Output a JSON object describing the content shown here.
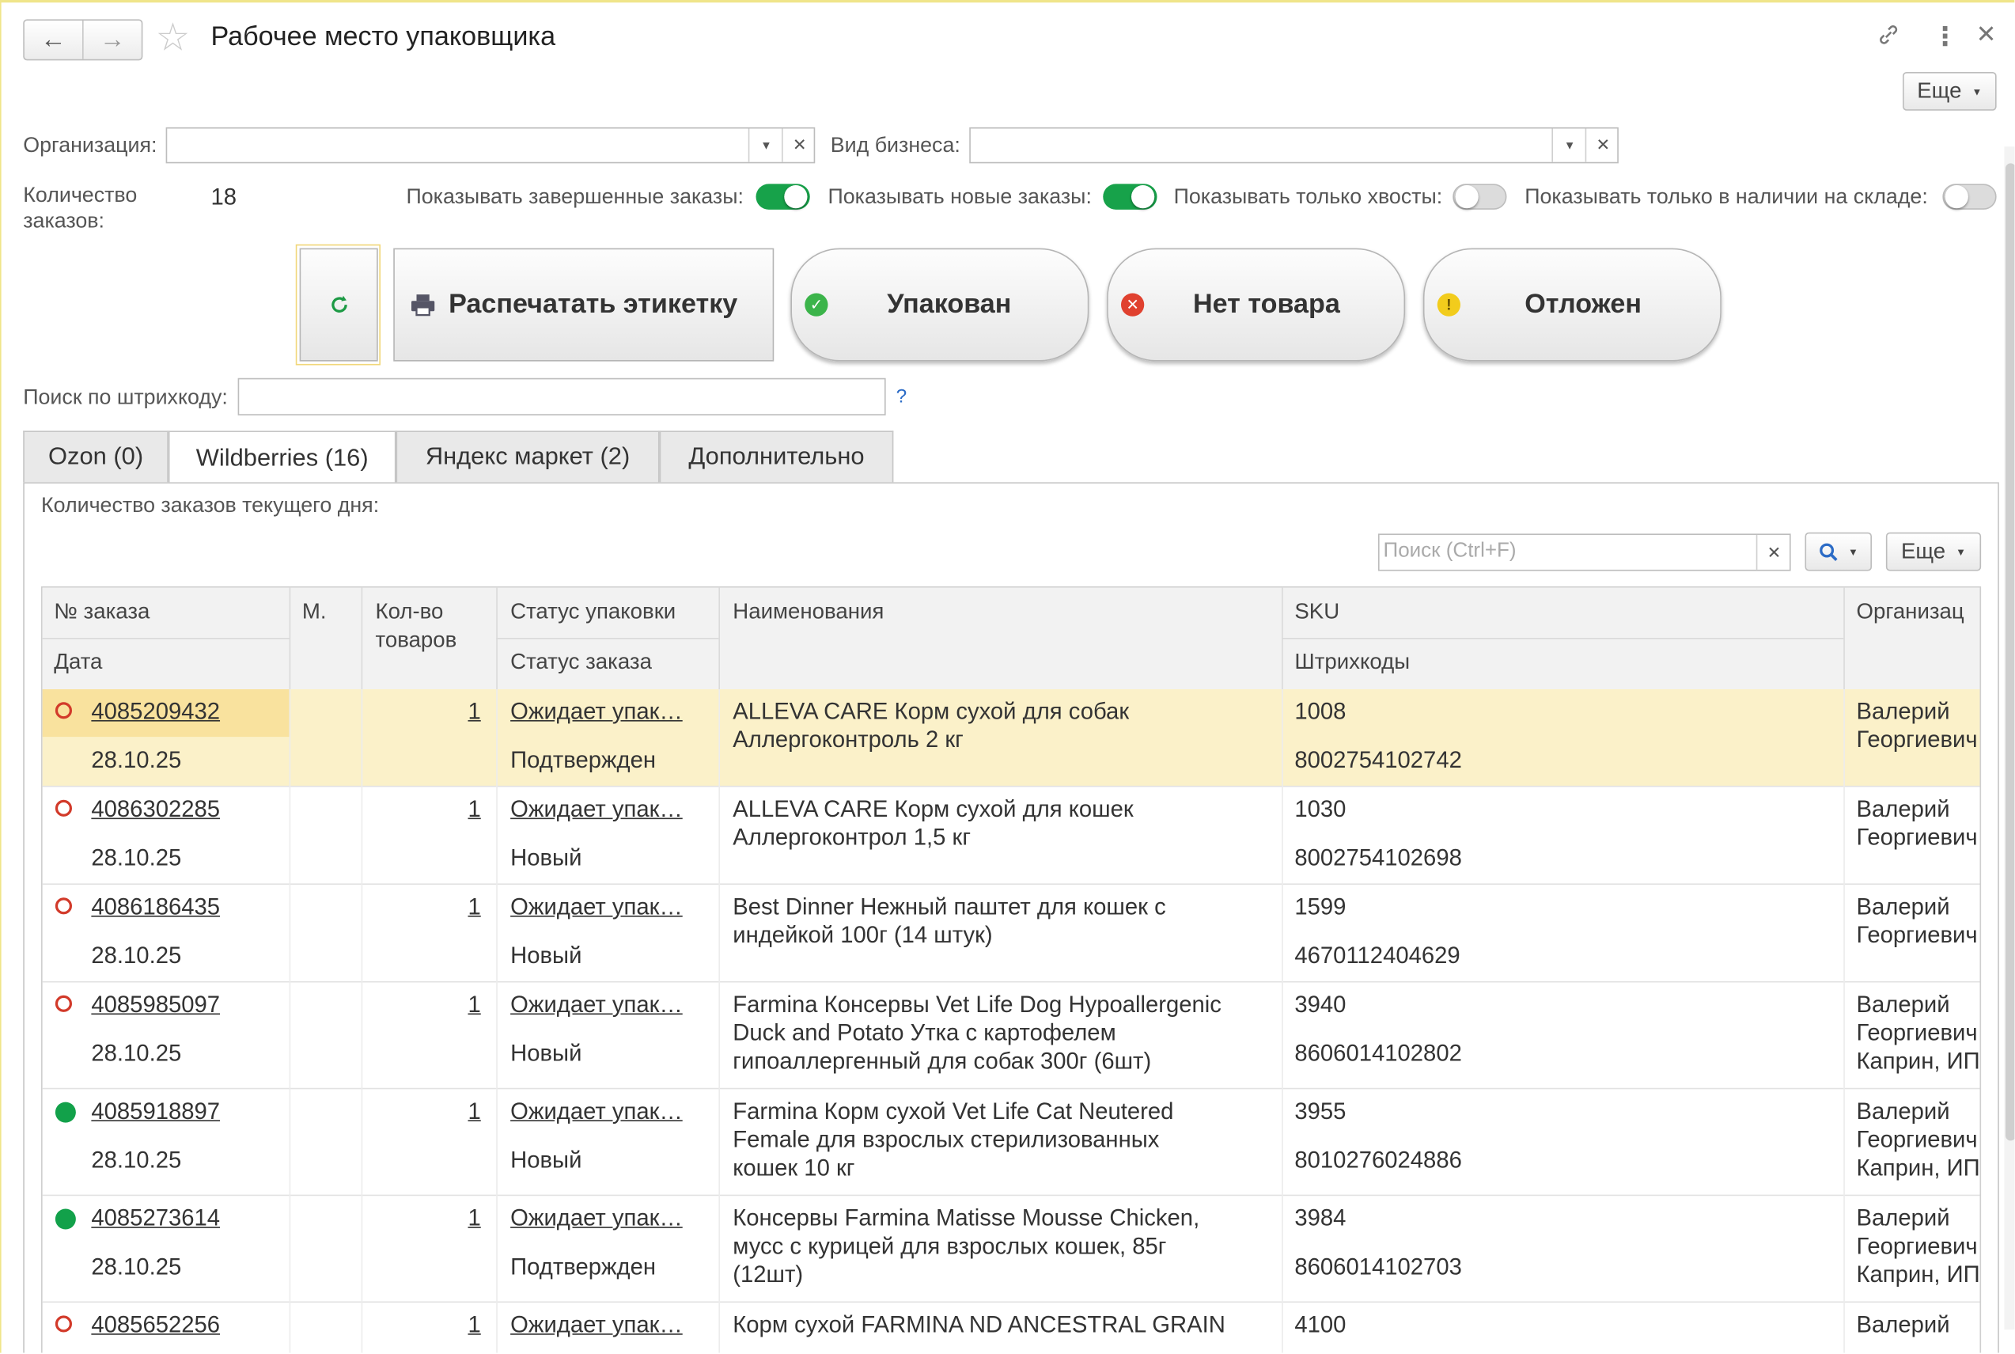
{
  "window": {
    "title": "Рабочее место упаковщика",
    "back_icon": "←",
    "forward_icon": "→",
    "more_label": "Еще"
  },
  "filters": {
    "organization_label": "Организация:",
    "business_label": "Вид бизнеса:",
    "orders_count_label_1": "Количество",
    "orders_count_label_2": "заказов:",
    "orders_count_value": "18",
    "show_completed_label": "Показывать завершенные заказы:",
    "show_new_label": "Показывать новые заказы:",
    "show_tails_label": "Показывать только хвосты:",
    "show_in_stock_label": "Показывать только в наличии на складе:",
    "show_completed": true,
    "show_new": true,
    "show_tails": false,
    "show_in_stock": false
  },
  "actions": {
    "print_label": "Распечатать этикетку",
    "packed_label": "Упакован",
    "no_item_label": "Нет товара",
    "postponed_label": "Отложен"
  },
  "barcode_search": {
    "label": "Поиск по штрихкоду:",
    "help": "?"
  },
  "tabs": [
    {
      "label": "Ozon (0)"
    },
    {
      "label": "Wildberries (16)"
    },
    {
      "label": "Яндекс маркет (2)"
    },
    {
      "label": "Дополнительно"
    }
  ],
  "panel": {
    "today_orders_label": "Количество заказов текущего дня:",
    "search_placeholder": "Поиск (Ctrl+F)",
    "more_label": "Еще"
  },
  "table": {
    "headers": {
      "order_no": "№ заказа",
      "date": "Дата",
      "m": "М.",
      "qty_1": "Кол-во",
      "qty_2": "товаров",
      "pack_status": "Статус упаковки",
      "order_status": "Статус заказа",
      "names": "Наименования",
      "sku": "SKU",
      "barcodes": "Штрихкоды",
      "org": "Организац"
    },
    "rows": [
      {
        "marker": "ring",
        "order": "4085209432",
        "date": "28.10.25",
        "qty": "1",
        "pack_status": "Ожидает упак…",
        "order_status": "Подтвержден",
        "name": [
          "ALLEVA CARE Корм сухой для собак",
          "Аллергоконтроль 2 кг"
        ],
        "sku": "1008",
        "barcode": "8002754102742",
        "org": [
          "Валерий",
          "Георгиевич"
        ]
      },
      {
        "marker": "ring",
        "order": "4086302285",
        "date": "28.10.25",
        "qty": "1",
        "pack_status": "Ожидает упак…",
        "order_status": "Новый",
        "name": [
          "ALLEVA CARE Корм сухой для кошек",
          "Аллергоконтрол 1,5 кг"
        ],
        "sku": "1030",
        "barcode": "8002754102698",
        "org": [
          "Валерий",
          "Георгиевич"
        ]
      },
      {
        "marker": "ring",
        "order": "4086186435",
        "date": "28.10.25",
        "qty": "1",
        "pack_status": "Ожидает упак…",
        "order_status": "Новый",
        "name": [
          "Best Dinner Нежный паштет для кошек с",
          "индейкой 100г (14 штук)"
        ],
        "sku": "1599",
        "barcode": "4670112404629",
        "org": [
          "Валерий",
          "Георгиевич"
        ]
      },
      {
        "marker": "ring",
        "order": "4085985097",
        "date": "28.10.25",
        "qty": "1",
        "pack_status": "Ожидает упак…",
        "order_status": "Новый",
        "name": [
          "Farmina Консервы Vet Life Dog Hypoallergenic",
          "Duck and Potato Утка с картофелем",
          "гипоаллергенный для собак 300г (6шт)"
        ],
        "sku": "3940",
        "barcode": "8606014102802",
        "org": [
          "Валерий",
          "Георгиевич",
          "Каприн, ИП"
        ]
      },
      {
        "marker": "dot",
        "order": "4085918897",
        "date": "28.10.25",
        "qty": "1",
        "pack_status": "Ожидает упак…",
        "order_status": "Новый",
        "name": [
          "Farmina Корм сухой Vet Life Cat Neutered",
          "Female для взрослых стерилизованных",
          "кошек 10 кг"
        ],
        "sku": "3955",
        "barcode": "8010276024886",
        "org": [
          "Валерий",
          "Георгиевич",
          "Каприн, ИП"
        ]
      },
      {
        "marker": "dot",
        "order": "4085273614",
        "date": "28.10.25",
        "qty": "1",
        "pack_status": "Ожидает упак…",
        "order_status": "Подтвержден",
        "name": [
          "Консервы Farmina Matisse Mousse Chicken,",
          "мусс с курицей для взрослых кошек, 85г",
          "(12шт)"
        ],
        "sku": "3984",
        "barcode": "8606014102703",
        "org": [
          "Валерий",
          "Георгиевич",
          "Каприн, ИП"
        ]
      },
      {
        "marker": "ring",
        "order": "4085652256",
        "date": "",
        "qty": "1",
        "pack_status": "Ожидает упак…",
        "order_status": "",
        "name": [
          "Корм сухой FARMINA ND ANCESTRAL GRAIN"
        ],
        "sku": "4100",
        "barcode": "",
        "org": [
          "Валерий"
        ]
      }
    ]
  }
}
